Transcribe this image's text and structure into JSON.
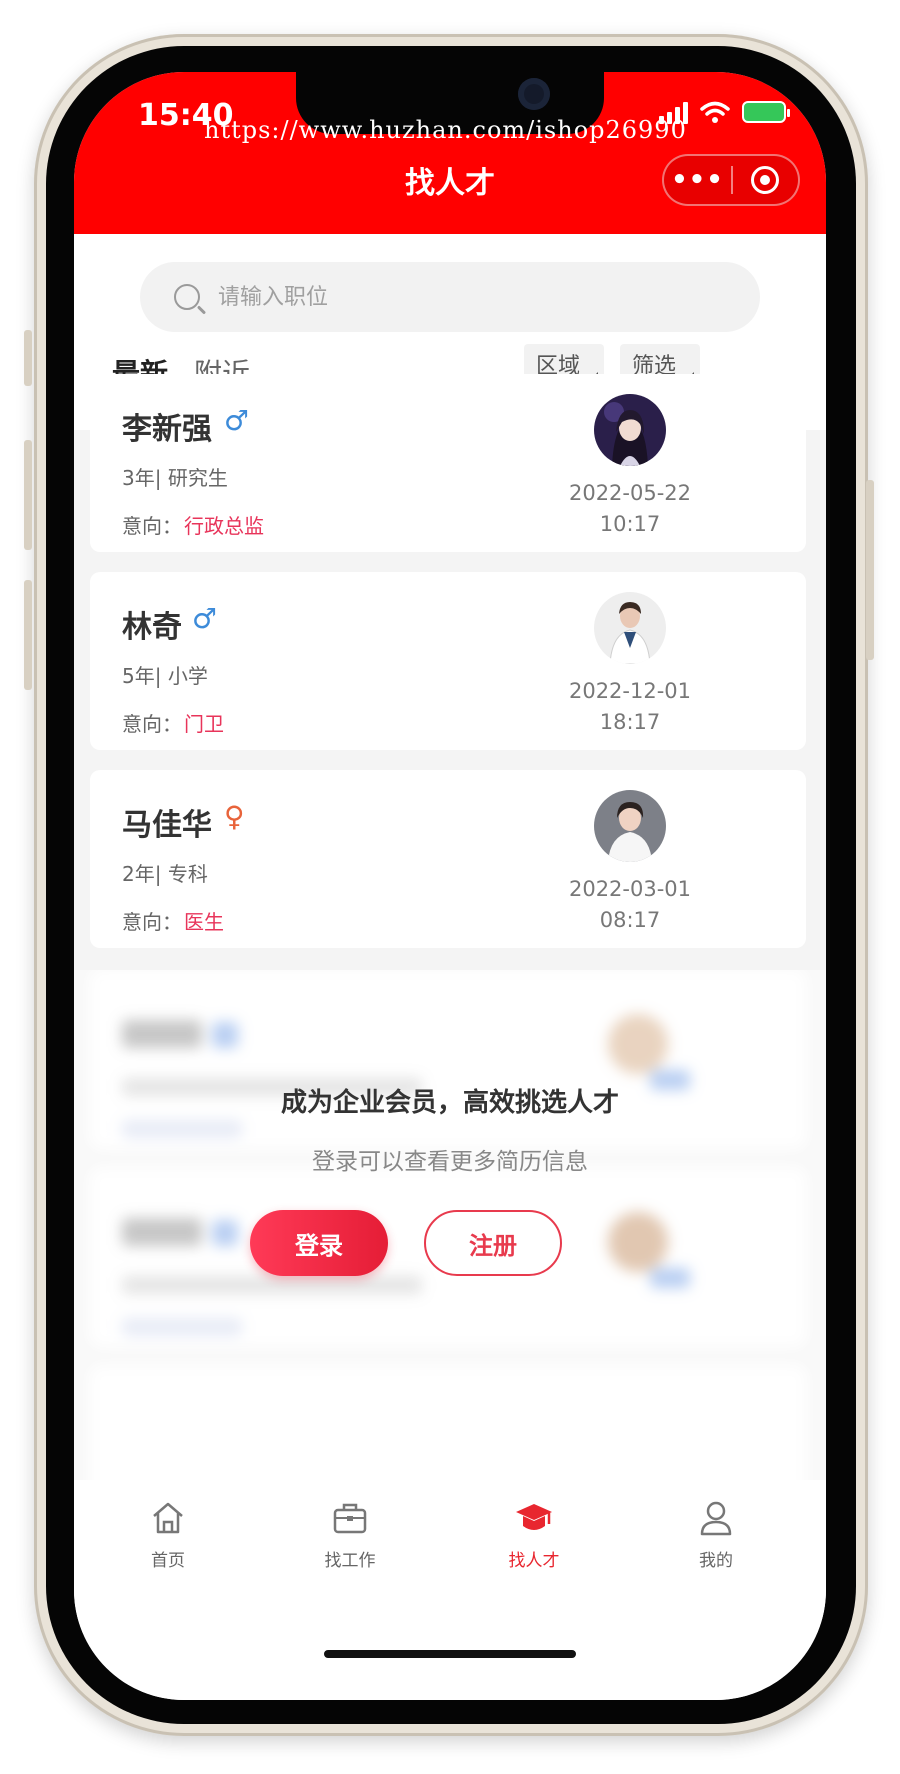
{
  "status_bar": {
    "time": "15:40"
  },
  "watermark": "https://www.huzhan.com/ishop26990",
  "header": {
    "title": "找人才",
    "more_glyph": "•••"
  },
  "search": {
    "placeholder": "请输入职位"
  },
  "tabs": [
    {
      "label": "最新",
      "active": true
    },
    {
      "label": "附近",
      "active": false
    }
  ],
  "filters": {
    "area_label": "区域",
    "filter_label": "筛选"
  },
  "candidates": [
    {
      "name": "李新强",
      "gender_symbol": "♂",
      "gender": "male",
      "experience": "3年| 研究生",
      "intent_label": "意向：",
      "intent": "行政总监",
      "date": "2022-05-22",
      "time": "10:17"
    },
    {
      "name": "林奇",
      "gender_symbol": "♂",
      "gender": "male",
      "experience": "5年| 小学",
      "intent_label": "意向：",
      "intent": "门卫",
      "date": "2022-12-01",
      "time": "18:17"
    },
    {
      "name": "马佳华",
      "gender_symbol": "♀",
      "gender": "female",
      "experience": "2年| 专科",
      "intent_label": "意向：",
      "intent": "医生",
      "date": "2022-03-01",
      "time": "08:17"
    }
  ],
  "login_prompt": {
    "title": "成为企业会员，高效挑选人才",
    "subtitle": "登录可以查看更多简历信息",
    "login_label": "登录",
    "register_label": "注册"
  },
  "tabbar": [
    {
      "label": "首页",
      "icon": "home-icon",
      "active": false
    },
    {
      "label": "找工作",
      "icon": "briefcase-icon",
      "active": false
    },
    {
      "label": "找人才",
      "icon": "graduation-cap-icon",
      "active": true
    },
    {
      "label": "我的",
      "icon": "user-icon",
      "active": false
    }
  ],
  "colors": {
    "brand_red": "#ff0000",
    "accent_pink": "#e8345a",
    "male_blue": "#3d8bd9",
    "female_orange": "#e8633a"
  }
}
